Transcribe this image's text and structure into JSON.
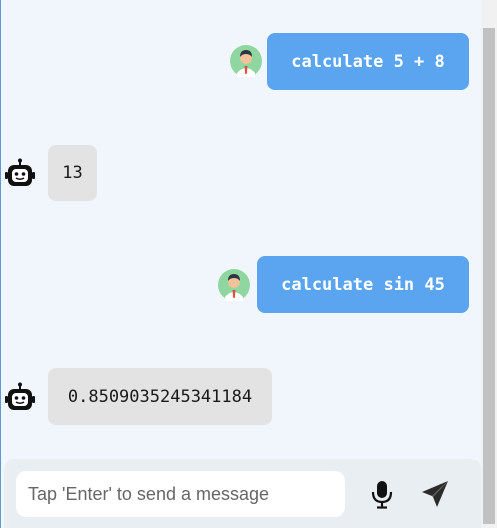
{
  "conversation": [
    {
      "sender": "user",
      "text": "calculate 5 + 8"
    },
    {
      "sender": "bot",
      "text": "13"
    },
    {
      "sender": "user",
      "text": "calculate sin 45"
    },
    {
      "sender": "bot",
      "text": "0.8509035245341184"
    }
  ],
  "input": {
    "placeholder": "Tap 'Enter' to send a message",
    "value": ""
  },
  "icons": {
    "user_avatar": "user-avatar-icon",
    "bot_avatar": "robot-icon",
    "mic": "microphone-icon",
    "send": "paper-plane-icon"
  },
  "colors": {
    "user_bubble": "#5ba4f0",
    "bot_bubble": "#e3e3e3",
    "chat_background": "#f0f6fb"
  }
}
